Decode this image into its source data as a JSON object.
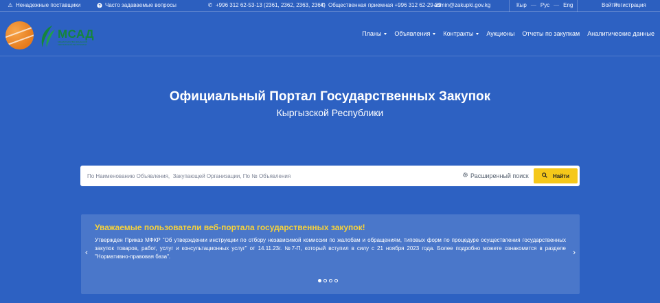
{
  "topbar": {
    "unreliable_suppliers": "Ненадежные поставщики",
    "faq": "Часто задаваемые вопросы",
    "phone": "+996 312 62-53-13 (2361, 2362, 2363, 2364)",
    "reception": "Общественная приемная +996 312 62-29-29",
    "email": "admin@zakupki.gov.kg",
    "languages": [
      "Кыр",
      "Рус",
      "Eng"
    ],
    "login": "Войти",
    "register": "Регистрация"
  },
  "logo": {
    "text": "МСАД",
    "subtitle": "МИНИСТЕРСТВО ФИНАНСОВ КЫРГЫЗСКОЙ РЕСПУБЛИКИ"
  },
  "nav": {
    "items": [
      {
        "label": "Планы",
        "dropdown": true
      },
      {
        "label": "Объявления",
        "dropdown": true
      },
      {
        "label": "Контракты",
        "dropdown": true
      },
      {
        "label": "Аукционы",
        "dropdown": false
      },
      {
        "label": "Отчеты по закупкам",
        "dropdown": false
      },
      {
        "label": "Аналитические данные",
        "dropdown": false
      }
    ]
  },
  "hero": {
    "title": "Официальный Портал Государственных Закупок",
    "subtitle": "Кыргызской Республики"
  },
  "search": {
    "placeholder": "По Наименованию Объявления,  Закупающей Организации, По № Объявления",
    "value": "",
    "advanced": "Расширенный поиск",
    "button": "Найти"
  },
  "notice": {
    "title": "Уважаемые пользователи веб-портала государственных закупок!",
    "body": "Утвержден Приказ МФКР \"Об утверждении инструкции по отбору независимой комиссии по жалобам и обращениям, типовых форм по процедуре осуществления государственных закупок товаров, работ, услуг и консультационных услуг\" от 14.11.23г. №7-П, который вступил в силу с 21 ноября 2023 года. Более подробно можете ознакомится в разделе \"Нормативно-правовая база\".",
    "slides": 4,
    "active_slide": 1
  },
  "colors": {
    "background": "#2d61c2",
    "accent": "#f5c81a",
    "notice_title": "#f7d23a",
    "logo_green": "#15853c",
    "logo_orange": "#e67b1d"
  }
}
